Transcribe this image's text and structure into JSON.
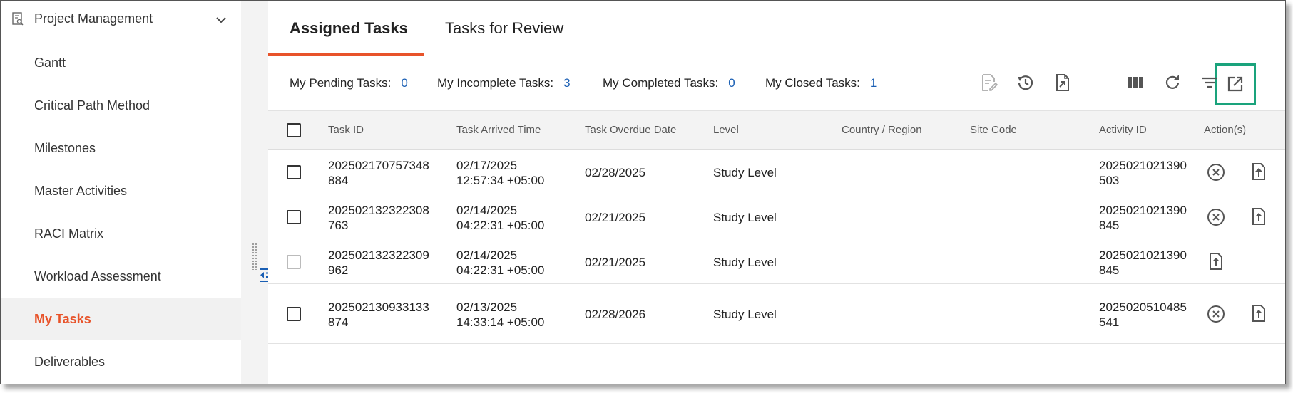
{
  "sidebar": {
    "title": "Project Management",
    "items": [
      {
        "label": "Gantt"
      },
      {
        "label": "Critical Path Method"
      },
      {
        "label": "Milestones"
      },
      {
        "label": "Master Activities"
      },
      {
        "label": "RACI Matrix"
      },
      {
        "label": "Workload Assessment"
      },
      {
        "label": "My Tasks",
        "active": true
      },
      {
        "label": "Deliverables"
      }
    ]
  },
  "tabs": [
    {
      "label": "Assigned Tasks",
      "active": true
    },
    {
      "label": "Tasks for Review"
    }
  ],
  "summary": {
    "pending_label": "My Pending Tasks:",
    "pending_value": "0",
    "incomplete_label": "My Incomplete Tasks:",
    "incomplete_value": "3",
    "completed_label": "My Completed Tasks:",
    "completed_value": "0",
    "closed_label": "My Closed Tasks:",
    "closed_value": "1"
  },
  "toolbar_icons": [
    "edit-document-icon",
    "history-icon",
    "export-document-icon",
    "open-external-icon",
    "columns-icon",
    "refresh-icon",
    "filter-icon"
  ],
  "table": {
    "headers": {
      "task_id": "Task ID",
      "arrived": "Task Arrived Time",
      "overdue": "Task Overdue Date",
      "level": "Level",
      "country": "Country / Region",
      "site": "Site Code",
      "activity": "Activity ID",
      "actions": "Action(s)"
    },
    "rows": [
      {
        "task_id_1": "202502170757348",
        "task_id_2": "884",
        "arrived_1": "02/17/2025",
        "arrived_2": "12:57:34 +05:00",
        "overdue": "02/28/2025",
        "level": "Study Level",
        "activity_1": "2025021021390",
        "activity_2": "503",
        "cancel": true
      },
      {
        "task_id_1": "202502132322308",
        "task_id_2": "763",
        "arrived_1": "02/14/2025",
        "arrived_2": "04:22:31 +05:00",
        "overdue": "02/21/2025",
        "level": "Study Level",
        "activity_1": "2025021021390",
        "activity_2": "845",
        "cancel": true
      },
      {
        "task_id_1": "202502132322309",
        "task_id_2": "962",
        "arrived_1": "02/14/2025",
        "arrived_2": "04:22:31 +05:00",
        "overdue": "02/21/2025",
        "level": "Study Level",
        "activity_1": "2025021021390",
        "activity_2": "845",
        "cancel": false
      },
      {
        "task_id_1": "202502130933133",
        "task_id_2": "874",
        "arrived_1": "02/13/2025",
        "arrived_2": "14:33:14 +05:00",
        "overdue": "02/28/2026",
        "level": "Study Level",
        "activity_1": "2025020510485",
        "activity_2": "541",
        "cancel": true
      }
    ]
  },
  "colors": {
    "accent": "#e8532a",
    "link": "#1a5fb4",
    "highlight": "#1aa37c"
  }
}
